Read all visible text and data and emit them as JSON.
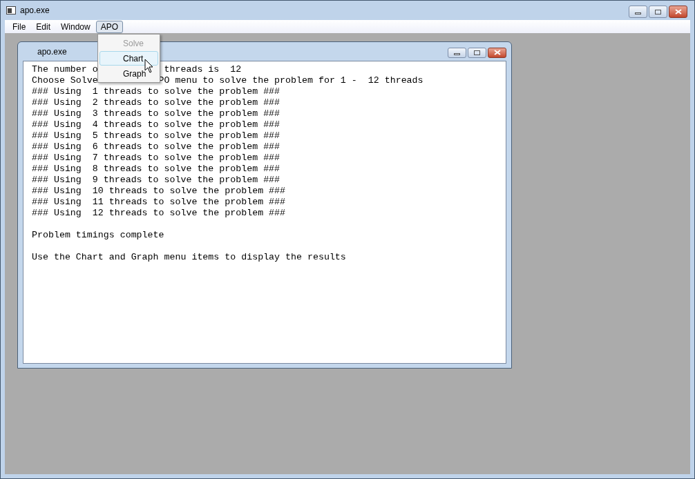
{
  "window": {
    "title": "apo.exe"
  },
  "menu_bar": [
    {
      "label": "File",
      "selected": false
    },
    {
      "label": "Edit",
      "selected": false
    },
    {
      "label": "Window",
      "selected": false
    },
    {
      "label": "APO",
      "selected": true
    }
  ],
  "dropdown": [
    {
      "label": "Solve",
      "disabled": true,
      "selected": false
    },
    {
      "label": "Chart",
      "disabled": false,
      "selected": true
    },
    {
      "label": "Graph",
      "disabled": false,
      "selected": false
    }
  ],
  "child_window": {
    "title": "apo.exe",
    "lines": [
      {
        "kind": "split",
        "left": "The number o",
        "right": "threads is  12"
      },
      {
        "kind": "split",
        "left": "Choose Solve",
        "right": "PO menu to solve the problem for 1 -  12 threads"
      },
      {
        "kind": "text",
        "text": "### Using  1 threads to solve the problem ###"
      },
      {
        "kind": "text",
        "text": "### Using  2 threads to solve the problem ###"
      },
      {
        "kind": "text",
        "text": "### Using  3 threads to solve the problem ###"
      },
      {
        "kind": "text",
        "text": "### Using  4 threads to solve the problem ###"
      },
      {
        "kind": "text",
        "text": "### Using  5 threads to solve the problem ###"
      },
      {
        "kind": "text",
        "text": "### Using  6 threads to solve the problem ###"
      },
      {
        "kind": "text",
        "text": "### Using  7 threads to solve the problem ###"
      },
      {
        "kind": "text",
        "text": "### Using  8 threads to solve the problem ###"
      },
      {
        "kind": "text",
        "text": "### Using  9 threads to solve the problem ###"
      },
      {
        "kind": "text",
        "text": "### Using  10 threads to solve the problem ###"
      },
      {
        "kind": "text",
        "text": "### Using  11 threads to solve the problem ###"
      },
      {
        "kind": "text",
        "text": "### Using  12 threads to solve the problem ###"
      },
      {
        "kind": "blank"
      },
      {
        "kind": "text",
        "text": "Problem timings complete"
      },
      {
        "kind": "blank"
      },
      {
        "kind": "text",
        "text": "Use the Chart and Graph menu items to display the results"
      }
    ]
  }
}
